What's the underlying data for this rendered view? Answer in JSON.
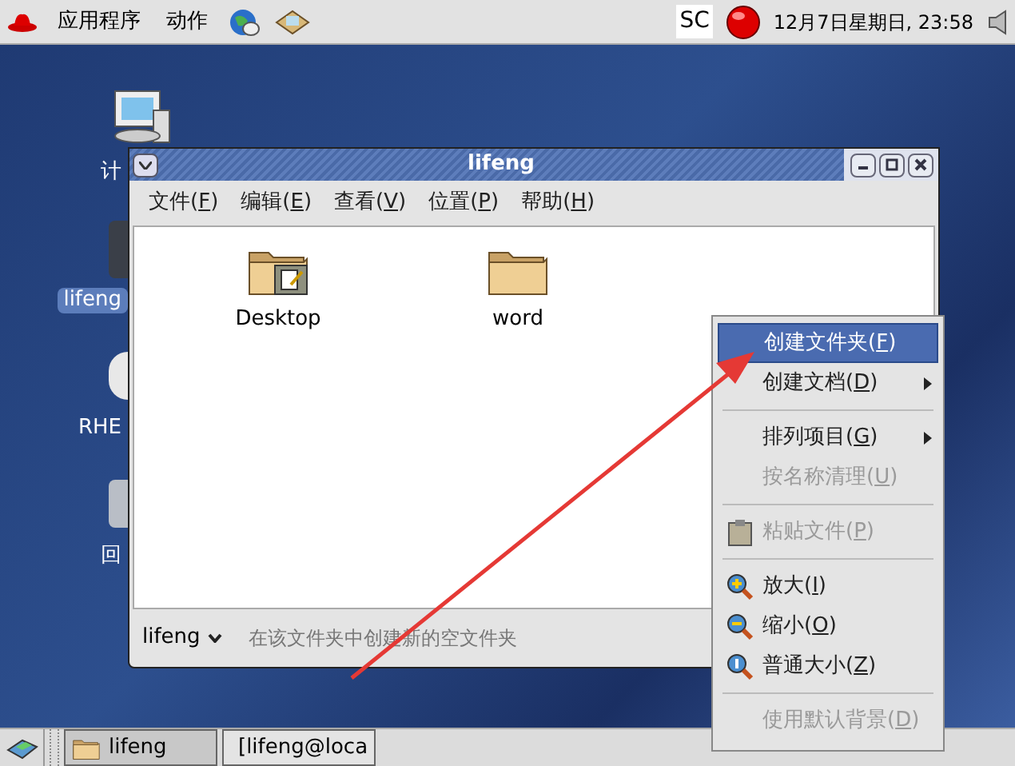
{
  "top_panel": {
    "menus": [
      "应用程序",
      "动作"
    ],
    "keyboard_indicator": "SC",
    "clock": "12月7日星期日, 23:58"
  },
  "desktop_icons": [
    {
      "label": "计",
      "kind": "computer",
      "selected": false
    },
    {
      "label": "lifeng",
      "kind": "home",
      "selected": true
    },
    {
      "label": "RHE",
      "kind": "disc",
      "selected": false
    },
    {
      "label": "回",
      "kind": "trash",
      "selected": false
    }
  ],
  "window": {
    "title": "lifeng",
    "menu": [
      "文件(F)",
      "编辑(E)",
      "查看(V)",
      "位置(P)",
      "帮助(H)"
    ],
    "files": [
      {
        "name": "Desktop",
        "kind": "desktop"
      },
      {
        "name": "word",
        "kind": "folder"
      }
    ],
    "location": "lifeng",
    "status": "在该文件夹中创建新的空文件夹"
  },
  "context_menu": [
    {
      "kind": "plain",
      "label": "创建文件夹(F)",
      "selected": true,
      "disabled": false,
      "submenu": false
    },
    {
      "kind": "plain",
      "label": "创建文档(D)",
      "selected": false,
      "disabled": false,
      "submenu": true
    },
    {
      "kind": "separator"
    },
    {
      "kind": "plain",
      "label": "排列项目(G)",
      "selected": false,
      "disabled": false,
      "submenu": true
    },
    {
      "kind": "plain",
      "label": "按名称清理(U)",
      "selected": false,
      "disabled": true,
      "submenu": false
    },
    {
      "kind": "separator"
    },
    {
      "kind": "paste",
      "label": "粘贴文件(P)",
      "selected": false,
      "disabled": true,
      "submenu": false
    },
    {
      "kind": "separator"
    },
    {
      "kind": "zoom_in",
      "label": "放大(I)",
      "selected": false,
      "disabled": false,
      "submenu": false
    },
    {
      "kind": "zoom_out",
      "label": "缩小(O)",
      "selected": false,
      "disabled": false,
      "submenu": false
    },
    {
      "kind": "zoom_normal",
      "label": "普通大小(Z)",
      "selected": false,
      "disabled": false,
      "submenu": false
    },
    {
      "kind": "separator"
    },
    {
      "kind": "plain",
      "label": "使用默认背景(D)",
      "selected": false,
      "disabled": true,
      "submenu": false
    }
  ],
  "taskbar": [
    {
      "label": "lifeng",
      "kind": "folder",
      "selected": true
    },
    {
      "label": "[lifeng@loca",
      "kind": "terminal",
      "selected": false
    }
  ]
}
